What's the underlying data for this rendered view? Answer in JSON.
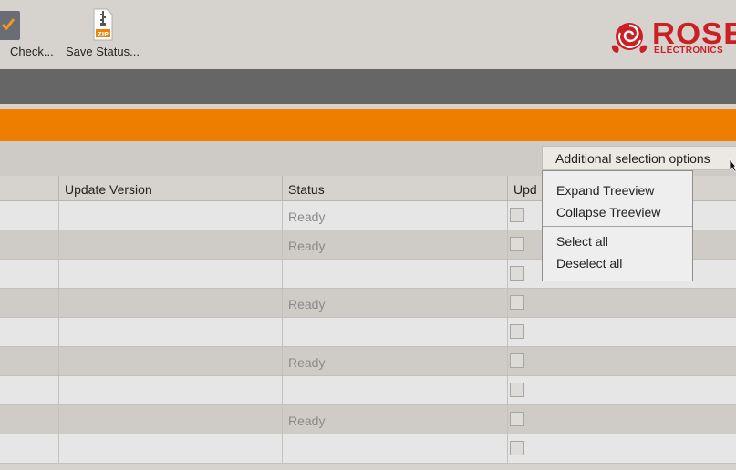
{
  "toolbar": {
    "check_label": "Check...",
    "save_status_label": "Save Status...",
    "zip_badge": "ZIP"
  },
  "logo": {
    "brand": "ROSE",
    "subtitle": "ELECTRONICS"
  },
  "selection": {
    "button_label": "Additional selection options",
    "menu": {
      "expand": "Expand Treeview",
      "collapse": "Collapse Treeview",
      "select_all": "Select all",
      "deselect_all": "Deselect all"
    }
  },
  "table": {
    "columns": [
      "",
      "Update Version",
      "Status",
      "Upd"
    ],
    "rows": [
      {
        "status": "Ready"
      },
      {
        "status": "Ready"
      },
      {
        "status": ""
      },
      {
        "status": "Ready"
      },
      {
        "status": ""
      },
      {
        "status": "Ready"
      },
      {
        "status": ""
      },
      {
        "status": "Ready"
      },
      {
        "status": ""
      }
    ]
  },
  "colors": {
    "accent_orange": "#ee7e00",
    "brand_red": "#cc1f24",
    "dark_bar": "#666666"
  },
  "icons": [
    "check-icon",
    "zip-file-icon",
    "rose-logo-icon",
    "mouse-cursor-icon"
  ]
}
